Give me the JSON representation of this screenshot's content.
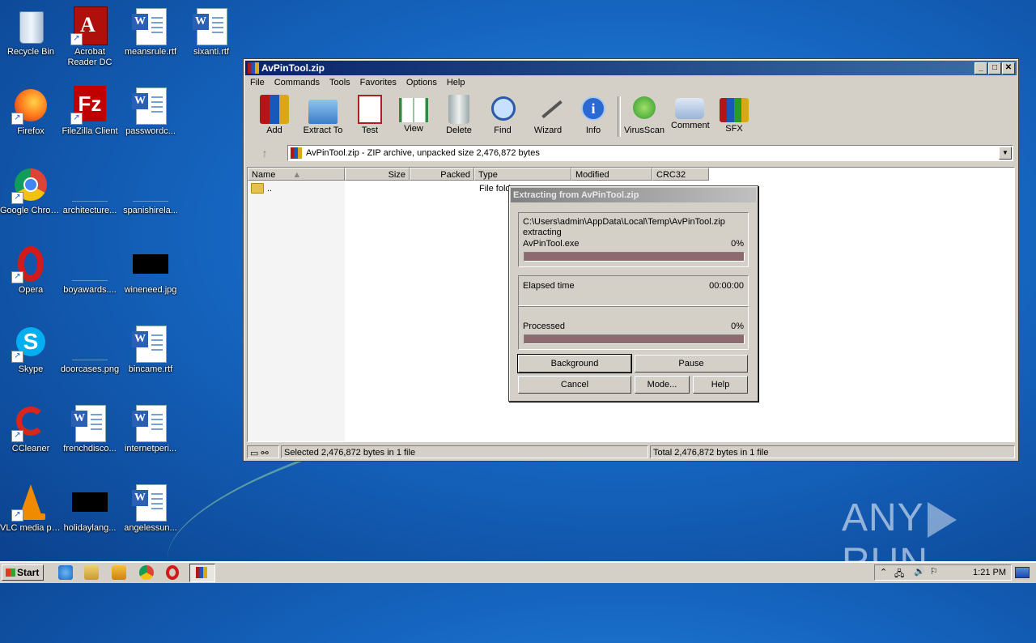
{
  "desktop": {
    "icons": [
      {
        "label": "Recycle Bin"
      },
      {
        "label": "Acrobat Reader DC"
      },
      {
        "label": "meansrule.rtf"
      },
      {
        "label": "sixanti.rtf"
      },
      {
        "label": "Firefox"
      },
      {
        "label": "FileZilla Client"
      },
      {
        "label": "passwordc..."
      },
      {
        "label": "Google Chrome"
      },
      {
        "label": "architecture..."
      },
      {
        "label": "spanishirela..."
      },
      {
        "label": "Opera"
      },
      {
        "label": "boyawards...."
      },
      {
        "label": "wineneed.jpg"
      },
      {
        "label": "Skype"
      },
      {
        "label": "doorcases.png"
      },
      {
        "label": "bincame.rtf"
      },
      {
        "label": "CCleaner"
      },
      {
        "label": "frenchdisco..."
      },
      {
        "label": "internetperi..."
      },
      {
        "label": "VLC media player"
      },
      {
        "label": "holidaylang..."
      },
      {
        "label": "angelessun..."
      }
    ]
  },
  "window": {
    "title": "AvPinTool.zip",
    "menu": [
      "File",
      "Commands",
      "Tools",
      "Favorites",
      "Options",
      "Help"
    ],
    "toolbar": [
      "Add",
      "Extract To",
      "Test",
      "View",
      "Delete",
      "Find",
      "Wizard",
      "Info",
      "VirusScan",
      "Comment",
      "SFX"
    ],
    "address": "AvPinTool.zip - ZIP archive, unpacked size 2,476,872 bytes",
    "columns": [
      "Name",
      "Size",
      "Packed",
      "Type",
      "Modified",
      "CRC32"
    ],
    "rows": [
      {
        "name": "..",
        "type": "File fold"
      }
    ],
    "status_left": "Selected 2,476,872 bytes in 1 file",
    "status_right": "Total 2,476,872 bytes in 1 file"
  },
  "dialog": {
    "title": "Extracting from AvPinTool.zip",
    "archive_path": "C:\\Users\\admin\\AppData\\Local\\Temp\\AvPinTool.zip",
    "action": "extracting",
    "file": "AvPinTool.exe",
    "file_percent": "0%",
    "elapsed_label": "Elapsed time",
    "elapsed_value": "00:00:00",
    "processed_label": "Processed",
    "processed_percent": "0%",
    "buttons": {
      "background": "Background",
      "pause": "Pause",
      "cancel": "Cancel",
      "mode": "Mode...",
      "help": "Help"
    }
  },
  "taskbar": {
    "start": "Start",
    "clock": "1:21 PM"
  },
  "watermark": {
    "left": "ANY",
    "right": "RUN"
  }
}
